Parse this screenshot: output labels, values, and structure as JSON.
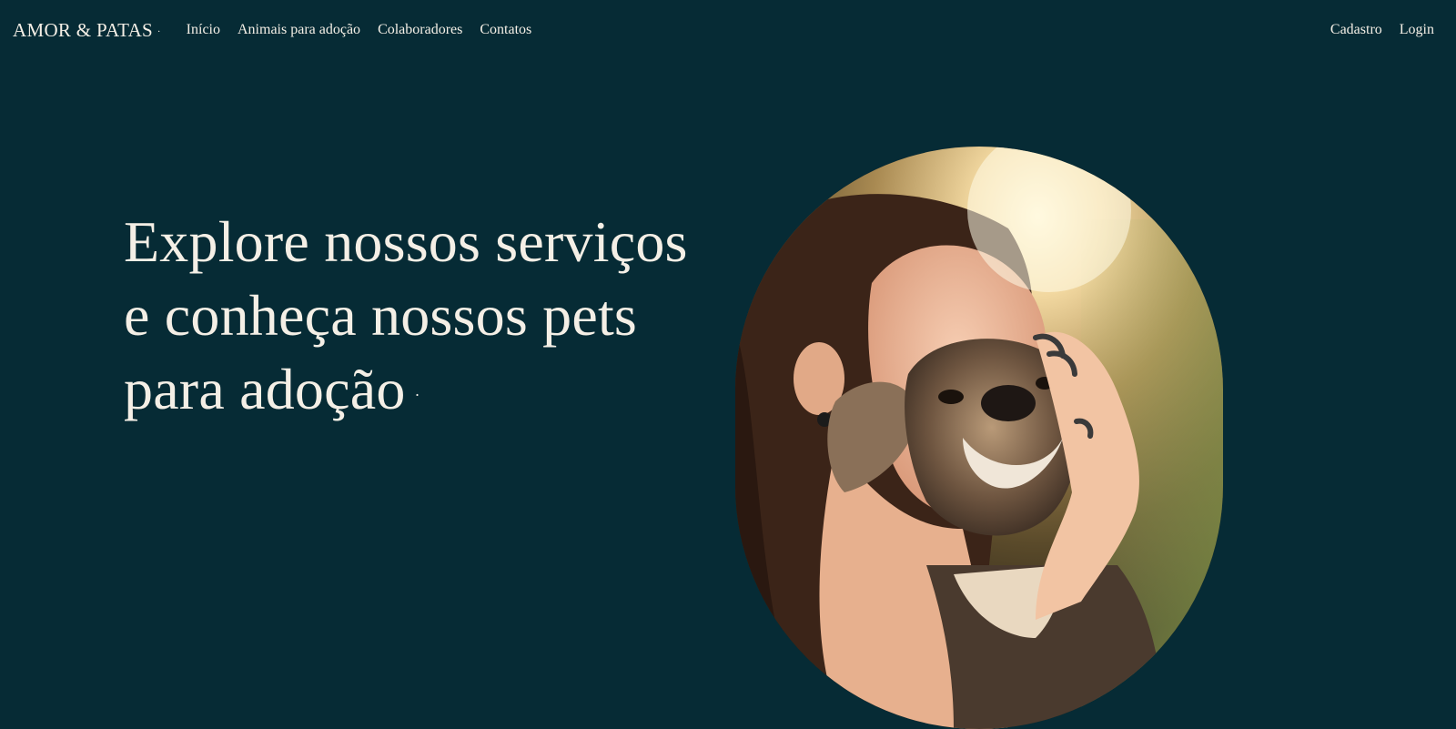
{
  "brand": {
    "name": "AMOR & PATAS",
    "dot": "·"
  },
  "nav": {
    "links": [
      {
        "label": "Início"
      },
      {
        "label": "Animais para adoção"
      },
      {
        "label": "Colaboradores"
      },
      {
        "label": "Contatos"
      }
    ],
    "right": [
      {
        "label": "Cadastro"
      },
      {
        "label": "Login"
      }
    ]
  },
  "hero": {
    "title_line1": "Explore nossos serviços",
    "title_line2": "e conheça nossos pets",
    "title_line3": "para adoção",
    "title_mark": "·",
    "image_description_icon": "woman-hugging-dog-photo"
  },
  "colors": {
    "background": "#062b35",
    "text": "#f4efe6"
  }
}
